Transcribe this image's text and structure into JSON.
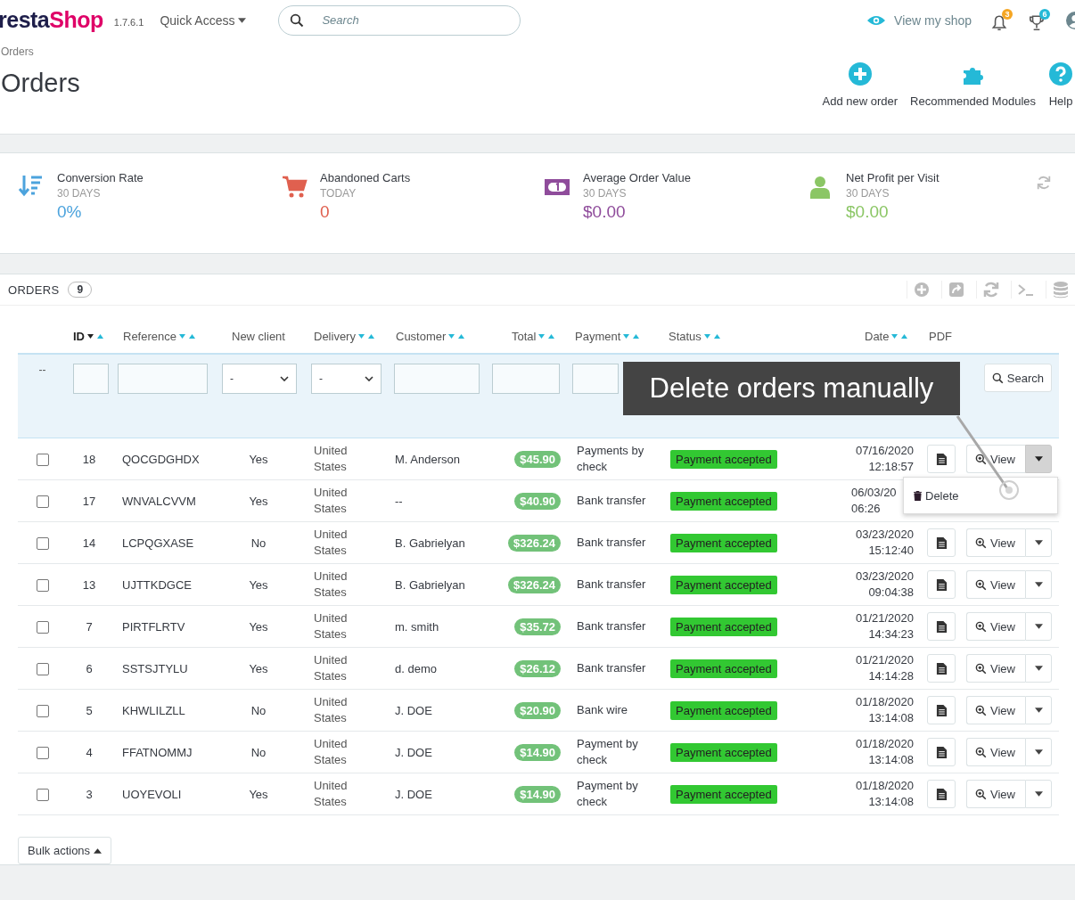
{
  "header": {
    "logo": {
      "dark": "resta",
      "accent": "Shop"
    },
    "version": "1.7.6.1",
    "quick_access": "Quick Access",
    "search": {
      "placeholder": "Search"
    },
    "view_shop": "View my shop",
    "notifications": [
      {
        "kind": "bell",
        "count": "3",
        "color": "#f5a623"
      },
      {
        "kind": "trophy",
        "count": "6",
        "color": "#25b9d7"
      }
    ]
  },
  "breadcrumb": "Orders",
  "title": "Orders",
  "toolbar": [
    {
      "kind": "plus",
      "label": "Add new order"
    },
    {
      "kind": "puzzle",
      "label": "Recommended Modules"
    },
    {
      "kind": "help",
      "label": "Help"
    }
  ],
  "kpis": [
    {
      "kind": "sort",
      "title": "Conversion Rate",
      "period": "30 DAYS",
      "value": "0%",
      "color": "#4ca3dd"
    },
    {
      "kind": "cart",
      "title": "Abandoned Carts",
      "period": "TODAY",
      "value": "0",
      "color": "#e0604f"
    },
    {
      "kind": "money",
      "title": "Average Order Value",
      "period": "30 DAYS",
      "value": "$0.00",
      "color": "#8f4c9b"
    },
    {
      "kind": "user",
      "title": "Net Profit per Visit",
      "period": "30 DAYS",
      "value": "$0.00",
      "color": "#8bc665"
    }
  ],
  "orders": {
    "title": "ORDERS",
    "count": "9",
    "columns": [
      {
        "label": "ID",
        "sortable": true,
        "active": true
      },
      {
        "label": "Reference",
        "sortable": true,
        "active": false
      },
      {
        "label": "New client",
        "sortable": false,
        "active": false
      },
      {
        "label": "Delivery",
        "sortable": true,
        "active": false
      },
      {
        "label": "Customer",
        "sortable": true,
        "active": false
      },
      {
        "label": "Total",
        "sortable": true,
        "active": false
      },
      {
        "label": "Payment",
        "sortable": true,
        "active": false
      },
      {
        "label": "Status",
        "sortable": true,
        "active": false
      },
      {
        "label": "Date",
        "sortable": true,
        "active": false
      },
      {
        "label": "PDF",
        "sortable": false,
        "active": false
      }
    ],
    "filters": {
      "lead": "--",
      "fields": [
        {
          "kind": "text"
        },
        {
          "kind": "text"
        },
        {
          "kind": "select",
          "value": "-"
        },
        {
          "kind": "select",
          "value": "-"
        },
        {
          "kind": "text"
        },
        {
          "kind": "text"
        },
        {
          "kind": "text"
        }
      ],
      "search_button": "Search"
    },
    "rows": [
      {
        "checked": false,
        "id": "18",
        "reference": "QOCGDGHDX",
        "new_client": "Yes",
        "delivery": "United States",
        "customer": "M. Anderson",
        "total": "$45.90",
        "payment": "Payments by check",
        "status": {
          "label": "Payment accepted",
          "color": "#32c832"
        },
        "date": "07/16/2020",
        "time": "12:18:57",
        "actions_visible": true,
        "view": "View",
        "menu_open": true
      },
      {
        "checked": false,
        "id": "17",
        "reference": "WNVALCVVM",
        "new_client": "Yes",
        "delivery": "United States",
        "customer": "--",
        "total": "$40.90",
        "payment": "Bank transfer",
        "status": {
          "label": "Payment accepted",
          "color": "#32c832"
        },
        "date": "06/03/20",
        "time": "06:26",
        "actions_visible": false,
        "view": "",
        "menu_open": false
      },
      {
        "checked": false,
        "id": "14",
        "reference": "LCPQGXASE",
        "new_client": "No",
        "delivery": "United States",
        "customer": "B. Gabrielyan",
        "total": "$326.24",
        "payment": "Bank transfer",
        "status": {
          "label": "Payment accepted",
          "color": "#32c832"
        },
        "date": "03/23/2020",
        "time": "15:12:40",
        "actions_visible": true,
        "view": "View",
        "menu_open": false
      },
      {
        "checked": false,
        "id": "13",
        "reference": "UJTTKDGCE",
        "new_client": "Yes",
        "delivery": "United States",
        "customer": "B. Gabrielyan",
        "total": "$326.24",
        "payment": "Bank transfer",
        "status": {
          "label": "Payment accepted",
          "color": "#32c832"
        },
        "date": "03/23/2020",
        "time": "09:04:38",
        "actions_visible": true,
        "view": "View",
        "menu_open": false
      },
      {
        "checked": false,
        "id": "7",
        "reference": "PIRTFLRTV",
        "new_client": "Yes",
        "delivery": "United States",
        "customer": "m. smith",
        "total": "$35.72",
        "payment": "Bank transfer",
        "status": {
          "label": "Payment accepted",
          "color": "#32c832"
        },
        "date": "01/21/2020",
        "time": "14:34:23",
        "actions_visible": true,
        "view": "View",
        "menu_open": false
      },
      {
        "checked": false,
        "id": "6",
        "reference": "SSTSJTYLU",
        "new_client": "Yes",
        "delivery": "United States",
        "customer": "d. demo",
        "total": "$26.12",
        "payment": "Bank transfer",
        "status": {
          "label": "Payment accepted",
          "color": "#32c832"
        },
        "date": "01/21/2020",
        "time": "14:14:28",
        "actions_visible": true,
        "view": "View",
        "menu_open": false
      },
      {
        "checked": false,
        "id": "5",
        "reference": "KHWLILZLL",
        "new_client": "No",
        "delivery": "United States",
        "customer": "J. DOE",
        "total": "$20.90",
        "payment": "Bank wire",
        "status": {
          "label": "Payment accepted",
          "color": "#32c832"
        },
        "date": "01/18/2020",
        "time": "13:14:08",
        "actions_visible": true,
        "view": "View",
        "menu_open": false
      },
      {
        "checked": false,
        "id": "4",
        "reference": "FFATNOMMJ",
        "new_client": "No",
        "delivery": "United States",
        "customer": "J. DOE",
        "total": "$14.90",
        "payment": "Payment by check",
        "status": {
          "label": "Payment accepted",
          "color": "#32c832"
        },
        "date": "01/18/2020",
        "time": "13:14:08",
        "actions_visible": true,
        "view": "View",
        "menu_open": false
      },
      {
        "checked": false,
        "id": "3",
        "reference": "UOYEVOLI",
        "new_client": "Yes",
        "delivery": "United States",
        "customer": "J. DOE",
        "total": "$14.90",
        "payment": "Payment by check",
        "status": {
          "label": "Payment accepted",
          "color": "#32c832"
        },
        "date": "01/18/2020",
        "time": "13:14:08",
        "actions_visible": true,
        "view": "View",
        "menu_open": false
      }
    ],
    "menu": {
      "item": "Delete"
    },
    "bulk_actions": "Bulk actions"
  },
  "callout": "Delete orders manually"
}
